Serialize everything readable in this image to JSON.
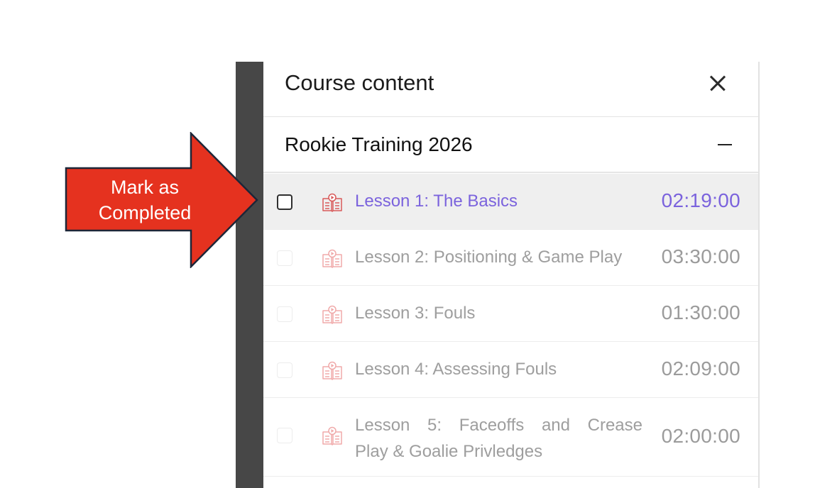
{
  "panel": {
    "title": "Course content",
    "close_icon": "close-icon",
    "section": {
      "title": "Rookie Training 2026",
      "toggle_icon": "minus-icon"
    },
    "lessons": [
      {
        "title": "Lesson 1: The Basics",
        "duration": "02:19:00",
        "active": true,
        "icon": "video-book-icon"
      },
      {
        "title": "Lesson 2: Positioning & Game Play",
        "duration": "03:30:00",
        "active": false,
        "icon": "video-book-icon"
      },
      {
        "title": "Lesson 3: Fouls",
        "duration": "01:30:00",
        "active": false,
        "icon": "video-book-icon"
      },
      {
        "title": "Lesson 4: Assessing Fouls",
        "duration": "02:09:00",
        "active": false,
        "icon": "video-book-icon"
      },
      {
        "title_line1": "Lesson 5: Faceoffs and Crease",
        "title_line2": "Play & Goalie Privledges",
        "duration": "02:00:00",
        "active": false,
        "icon": "video-book-icon"
      }
    ]
  },
  "callout": {
    "line1": "Mark as",
    "line2": "Completed",
    "color": "#e5321f",
    "outline": "#1d2638"
  },
  "colors": {
    "accent": "#7b63dd",
    "muted_text": "#9e9e9e",
    "icon_red": "#e06565",
    "active_row_bg": "#efefef"
  }
}
